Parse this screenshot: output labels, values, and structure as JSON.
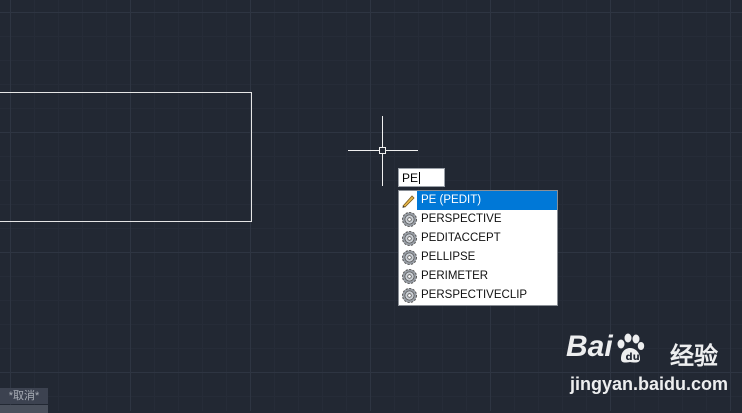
{
  "canvas": {
    "background": "#222833",
    "grid_major": "#2e3542",
    "grid_minor": "#262c38"
  },
  "command_input": {
    "value": "PE"
  },
  "autocomplete": {
    "selected_color": "#0078d7",
    "items": [
      {
        "label": "PE (PEDIT)",
        "icon": "pencil-icon"
      },
      {
        "label": "PERSPECTIVE",
        "icon": "gear-icon"
      },
      {
        "label": "PEDITACCEPT",
        "icon": "gear-icon"
      },
      {
        "label": "PELLIPSE",
        "icon": "gear-icon"
      },
      {
        "label": "PERIMETER",
        "icon": "gear-icon"
      },
      {
        "label": "PERSPECTIVECLIP",
        "icon": "gear-icon"
      }
    ]
  },
  "status": {
    "cancel_text": "*取消*"
  },
  "watermark": {
    "logo": "Bai",
    "logo_cn": "经验",
    "url": "jingyan.baidu.com"
  }
}
